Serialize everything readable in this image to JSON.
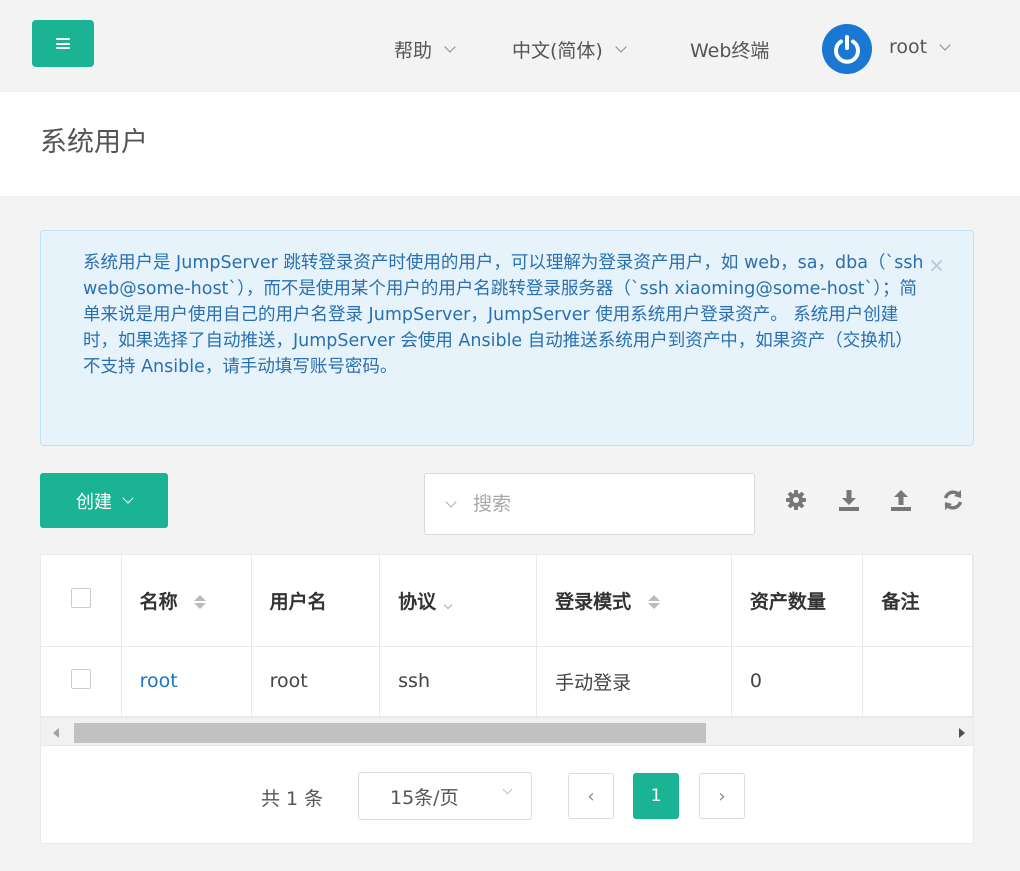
{
  "header": {
    "menu_icon": "hamburger-icon",
    "help_label": "帮助",
    "language_label": "中文(简体)",
    "web_terminal_label": "Web终端",
    "user_label": "root",
    "avatar_icon": "power-icon"
  },
  "page": {
    "title": "系统用户"
  },
  "alert": {
    "text": "系统用户是 JumpServer 跳转登录资产时使用的用户，可以理解为登录资产用户，如 web，sa，dba（`ssh web@some-host`），而不是使用某个用户的用户名跳转登录服务器（`ssh xiaoming@some-host`）；简单来说是用户使用自己的用户名登录 JumpServer，JumpServer 使用系统用户登录资产。 系统用户创建时，如果选择了自动推送，JumpServer 会使用 Ansible 自动推送系统用户到资产中，如果资产（交换机）不支持 Ansible，请手动填写账号密码。",
    "close_symbol": "×"
  },
  "toolbar": {
    "create_label": "创建",
    "search_placeholder": "搜索",
    "icons": [
      "gear-icon",
      "download-icon",
      "upload-icon",
      "refresh-icon"
    ]
  },
  "table": {
    "columns": [
      "名称",
      "用户名",
      "协议",
      "登录模式",
      "资产数量",
      "备注"
    ],
    "rows": [
      {
        "name": "root",
        "username": "root",
        "protocol": "ssh",
        "login_mode": "手动登录",
        "asset_count": "0",
        "comment": ""
      }
    ]
  },
  "pagination": {
    "total_label": "共 1 条",
    "page_size_label": "15条/页",
    "current_page": "1",
    "prev_symbol": "‹",
    "next_symbol": "›"
  },
  "colors": {
    "primary": "#1ab394",
    "avatar": "#1a77d2",
    "alert_text": "#2a6fb0",
    "alert_bg": "#e6f3fb",
    "link": "#1a73c2"
  }
}
